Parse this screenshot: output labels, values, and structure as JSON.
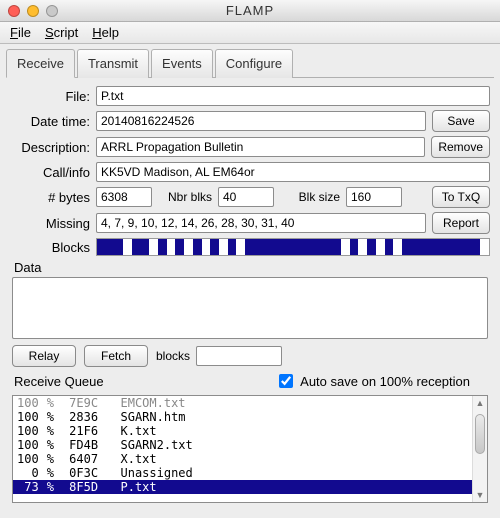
{
  "window": {
    "title": "FLAMP"
  },
  "menus": {
    "file": "File",
    "script": "Script",
    "help": "Help"
  },
  "tabs": [
    {
      "label": "Receive",
      "active": true
    },
    {
      "label": "Transmit",
      "active": false
    },
    {
      "label": "Events",
      "active": false
    },
    {
      "label": "Configure",
      "active": false
    }
  ],
  "labels": {
    "file": "File:",
    "date": "Date time:",
    "desc": "Description:",
    "call": "Call/info",
    "bytes": "# bytes",
    "nblks": "Nbr blks",
    "blksz": "Blk size",
    "missing": "Missing",
    "blocks": "Blocks",
    "data": "Data",
    "blocks2": "blocks",
    "queue": "Receive Queue",
    "autosave": "Auto save on 100% reception"
  },
  "fields": {
    "file": "P.txt",
    "date": "20140816224526",
    "desc": "ARRL Propagation Bulletin",
    "call": "KK5VD Madison, AL EM64or",
    "bytes": "6308",
    "nblks": "40",
    "blksz": "160",
    "missing": "4, 7, 9, 10, 12, 14, 26, 28, 30, 31, 40",
    "blocks_input": "",
    "autosave_checked": true
  },
  "buttons": {
    "save": "Save",
    "remove": "Remove",
    "totxq": "To TxQ",
    "report": "Report",
    "relay": "Relay",
    "fetch": "Fetch"
  },
  "blocks_pattern": [
    3,
    1,
    2,
    1,
    1,
    1,
    1,
    1,
    1,
    1,
    1,
    1,
    1,
    1,
    11,
    1,
    1,
    1,
    1,
    1,
    1,
    1,
    9,
    1
  ],
  "queue": [
    {
      "pct": "100",
      "u": "%",
      "id": "7E9C",
      "name": "EMCOM.txt",
      "first": true
    },
    {
      "pct": "100",
      "u": "%",
      "id": "2836",
      "name": "SGARN.htm"
    },
    {
      "pct": "100",
      "u": "%",
      "id": "21F6",
      "name": "K.txt"
    },
    {
      "pct": "100",
      "u": "%",
      "id": "FD4B",
      "name": "SGARN2.txt"
    },
    {
      "pct": "100",
      "u": "%",
      "id": "6407",
      "name": "X.txt"
    },
    {
      "pct": "  0",
      "u": "%",
      "id": "0F3C",
      "name": "Unassigned"
    },
    {
      "pct": " 73",
      "u": "%",
      "id": "8F5D",
      "name": "P.txt",
      "sel": true
    }
  ]
}
